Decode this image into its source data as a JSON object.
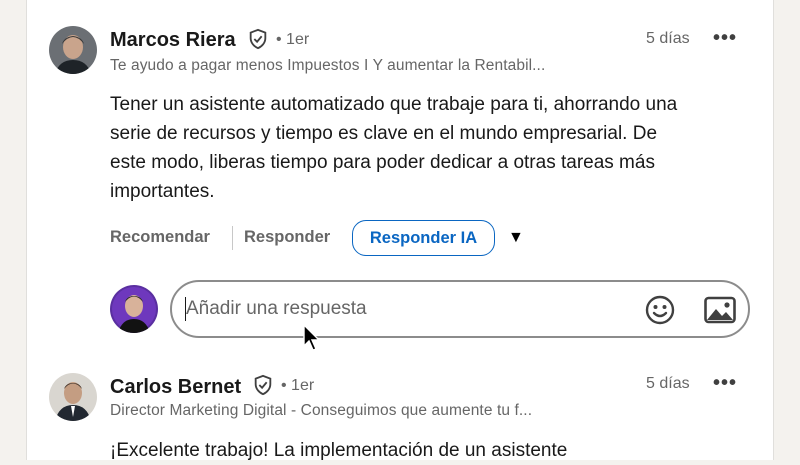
{
  "comments": [
    {
      "author": "Marcos Riera",
      "verified_icon": "shield-check-icon",
      "degree": "• 1er",
      "headline": "Te ayudo a pagar menos Impuestos I Y aumentar la Rentabil...",
      "time": "5 días",
      "more": "•••",
      "text_lines": [
        "Tener un asistente automatizado que trabaje para ti, ahorrando una",
        "serie de recursos y tiempo es clave en el mundo empresarial. De",
        "este modo, liberas tiempo para poder dedicar a otras tareas más",
        "importantes."
      ],
      "actions": {
        "recommend": "Recomendar",
        "reply": "Responder",
        "reply_ai": "Responder IA",
        "dropdown": "▼"
      }
    },
    {
      "author": "Carlos Bernet",
      "verified_icon": "shield-check-icon",
      "degree": "• 1er",
      "headline": "Director Marketing Digital - Conseguimos que aumente tu f...",
      "time": "5 días",
      "more": "•••",
      "text_lines": [
        "¡Excelente trabajo! La implementación de un asistente"
      ]
    }
  ],
  "reply_box": {
    "placeholder": "Añadir una respuesta",
    "emoji_icon": "emoji-icon",
    "image_icon": "image-icon"
  },
  "colors": {
    "accent": "#0a66c2",
    "muted": "#666666",
    "text": "#191919"
  }
}
